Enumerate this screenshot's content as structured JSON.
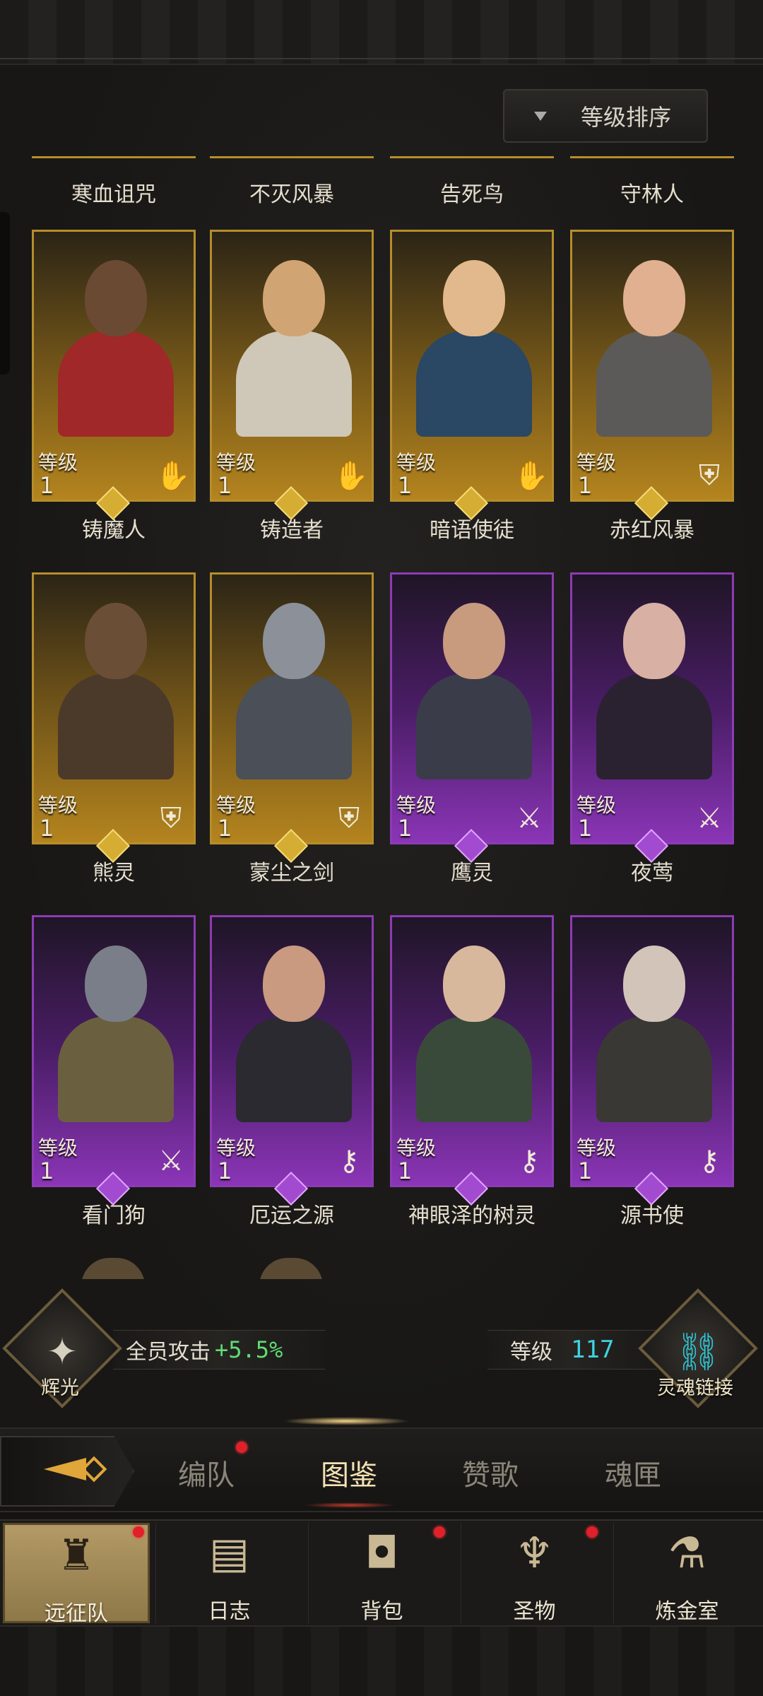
{
  "sort_button": {
    "label": "等级排序",
    "icon": "dropdown-triangle-icon"
  },
  "top_partial_names": [
    "寒血诅咒",
    "不灭风暴",
    "告死鸟",
    "守林人"
  ],
  "heroes": [
    {
      "name": "铸魔人",
      "level_label": "等级",
      "level": "1",
      "rarity": "gold",
      "role_icon": "hand-icon",
      "skin": "#6b4a34",
      "outfit": "#a02828"
    },
    {
      "name": "铸造者",
      "level_label": "等级",
      "level": "1",
      "rarity": "gold",
      "role_icon": "hand-icon",
      "skin": "#d1a474",
      "outfit": "#cfc8b8"
    },
    {
      "name": "暗语使徒",
      "level_label": "等级",
      "level": "1",
      "rarity": "gold",
      "role_icon": "hand-icon",
      "skin": "#e2b98c",
      "outfit": "#2a4764"
    },
    {
      "name": "赤红风暴",
      "level_label": "等级",
      "level": "1",
      "rarity": "gold",
      "role_icon": "shield-icon",
      "skin": "#e0b090",
      "outfit": "#5c5a58"
    },
    {
      "name": "熊灵",
      "level_label": "等级",
      "level": "1",
      "rarity": "gold",
      "role_icon": "shield-icon",
      "skin": "#6a4e36",
      "outfit": "#4b3a2a"
    },
    {
      "name": "蒙尘之剑",
      "level_label": "等级",
      "level": "1",
      "rarity": "gold",
      "role_icon": "shield-icon",
      "skin": "#8c9098",
      "outfit": "#4a4f58"
    },
    {
      "name": "鹰灵",
      "level_label": "等级",
      "level": "1",
      "rarity": "purple",
      "role_icon": "sword-icon",
      "skin": "#c89a7e",
      "outfit": "#3a3c4a"
    },
    {
      "name": "夜莺",
      "level_label": "等级",
      "level": "1",
      "rarity": "purple",
      "role_icon": "sword-icon",
      "skin": "#d8b0a4",
      "outfit": "#2a2230"
    },
    {
      "name": "看门狗",
      "level_label": "等级",
      "level": "1",
      "rarity": "purple",
      "role_icon": "sword-icon",
      "skin": "#7a7e88",
      "outfit": "#6a6040"
    },
    {
      "name": "厄运之源",
      "level_label": "等级",
      "level": "1",
      "rarity": "purple",
      "role_icon": "key-icon",
      "skin": "#c99a80",
      "outfit": "#2a2a30"
    },
    {
      "name": "神眼泽的树灵",
      "level_label": "等级",
      "level": "1",
      "rarity": "purple",
      "role_icon": "key-icon",
      "skin": "#d8b89c",
      "outfit": "#3a4a3a"
    },
    {
      "name": "源书使",
      "level_label": "等级",
      "level": "1",
      "rarity": "purple",
      "role_icon": "key-icon",
      "skin": "#d2c4b8",
      "outfit": "#3a3834"
    }
  ],
  "status": {
    "left_emblem_label": "辉光",
    "left_emblem_icon": "compass-star-icon",
    "stat_label": "全员攻击",
    "stat_value": "+5.5%",
    "level_label": "等级",
    "level_value": "117",
    "right_emblem_label": "灵魂链接",
    "right_emblem_icon": "chain-link-icon"
  },
  "tabs": [
    {
      "label": "编队",
      "active": false,
      "badge": true
    },
    {
      "label": "图鉴",
      "active": true,
      "badge": false
    },
    {
      "label": "赞歌",
      "active": false,
      "badge": false
    },
    {
      "label": "魂匣",
      "active": false,
      "badge": false
    }
  ],
  "bottom_nav": [
    {
      "label": "远征队",
      "icon": "horned-helmet-icon",
      "active": true,
      "badge": true
    },
    {
      "label": "日志",
      "icon": "scroll-map-icon",
      "active": false,
      "badge": false
    },
    {
      "label": "背包",
      "icon": "backpack-icon",
      "active": false,
      "badge": true
    },
    {
      "label": "圣物",
      "icon": "chalice-icon",
      "active": false,
      "badge": true
    },
    {
      "label": "炼金室",
      "icon": "alchemy-icon",
      "active": false,
      "badge": false
    }
  ],
  "colors": {
    "gold": "#b58d2b",
    "purple": "#8c3bb5",
    "bonus_green": "#5fdc74",
    "level_cyan": "#3fd2df",
    "badge_red": "#e0202a"
  }
}
